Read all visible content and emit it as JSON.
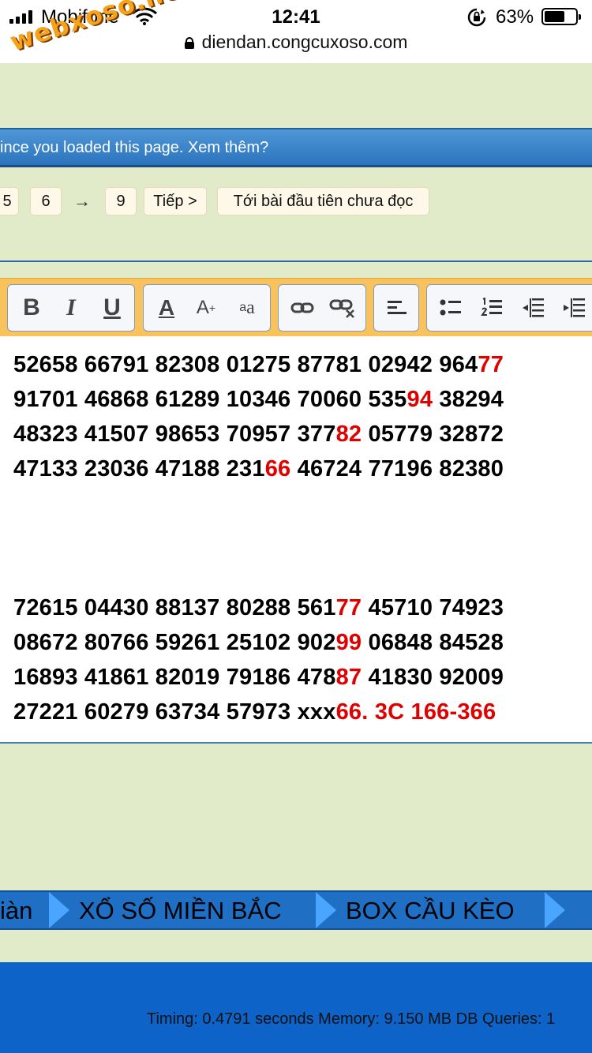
{
  "status": {
    "carrier": "Mobifone",
    "time": "12:41",
    "battery": "63%",
    "battery_level": 0.63,
    "url": "diendan.congcuxoso.com",
    "watermark": "webxoso.net"
  },
  "notice": {
    "text": "ince you loaded this page. Xem thêm?"
  },
  "pagination": {
    "pages": [
      "5",
      "6"
    ],
    "ellipsis_arrow": "→",
    "last_page": "9",
    "next": "Tiếp >",
    "first_unread": "Tới bài đầu tiên chưa đọc"
  },
  "toolbar": {
    "icons": [
      "bold-icon",
      "italic-icon",
      "underline-icon",
      "font-color-icon",
      "font-size-icon",
      "font-face-icon",
      "link-icon",
      "unlink-icon",
      "align-left-icon",
      "bullet-list-icon",
      "numbered-list-icon",
      "outdent-icon",
      "indent-icon"
    ],
    "bold": "B",
    "italic": "I",
    "underline": "U",
    "font_color": "A",
    "font_size": "A",
    "font_size_sup": "+",
    "font_face": "a",
    "font_face_sub": "a"
  },
  "post": {
    "block1": [
      {
        "pre": "52658 66791 82308 01275 87781 02942 964",
        "red": "77",
        "post": ""
      },
      {
        "pre": "91701 46868 61289 10346 70060 535",
        "red": "94",
        "post": " 38294"
      },
      {
        "pre": "48323 41507 98653 70957 377",
        "red": "82",
        "post": " 05779 32872"
      },
      {
        "pre": "47133 23036 47188 231",
        "red": "66",
        "post": " 46724 77196 82380"
      }
    ],
    "block2": [
      {
        "pre": "72615 04430 88137 80288 561",
        "red": "77",
        "post": " 45710 74923"
      },
      {
        "pre": "08672 80766 59261 25102 902",
        "red": "99",
        "post": " 06848 84528"
      },
      {
        "pre": "16893 41861 82019 79186 478",
        "red": "87",
        "post": " 41830 92009"
      },
      {
        "pre": "27221 60279 63734 57973 xxx",
        "red": "66. 3C 166-366",
        "post": ""
      }
    ]
  },
  "nav": {
    "items": [
      "iàn",
      "XỔ SỐ MIỀN BẮC",
      "BOX CẦU KÈO"
    ]
  },
  "footer": {
    "text": "Timing: 0.4791 seconds Memory: 9.150 MB DB Queries: 1"
  },
  "colors": {
    "page_bg": "#e1ebc9",
    "notice_bg": "#2b74bd",
    "toolbar_bg": "#f8c25c",
    "highlight_red": "#e00000",
    "nav_bg": "#1f6fc4",
    "footer_bg": "#0d63c7"
  }
}
